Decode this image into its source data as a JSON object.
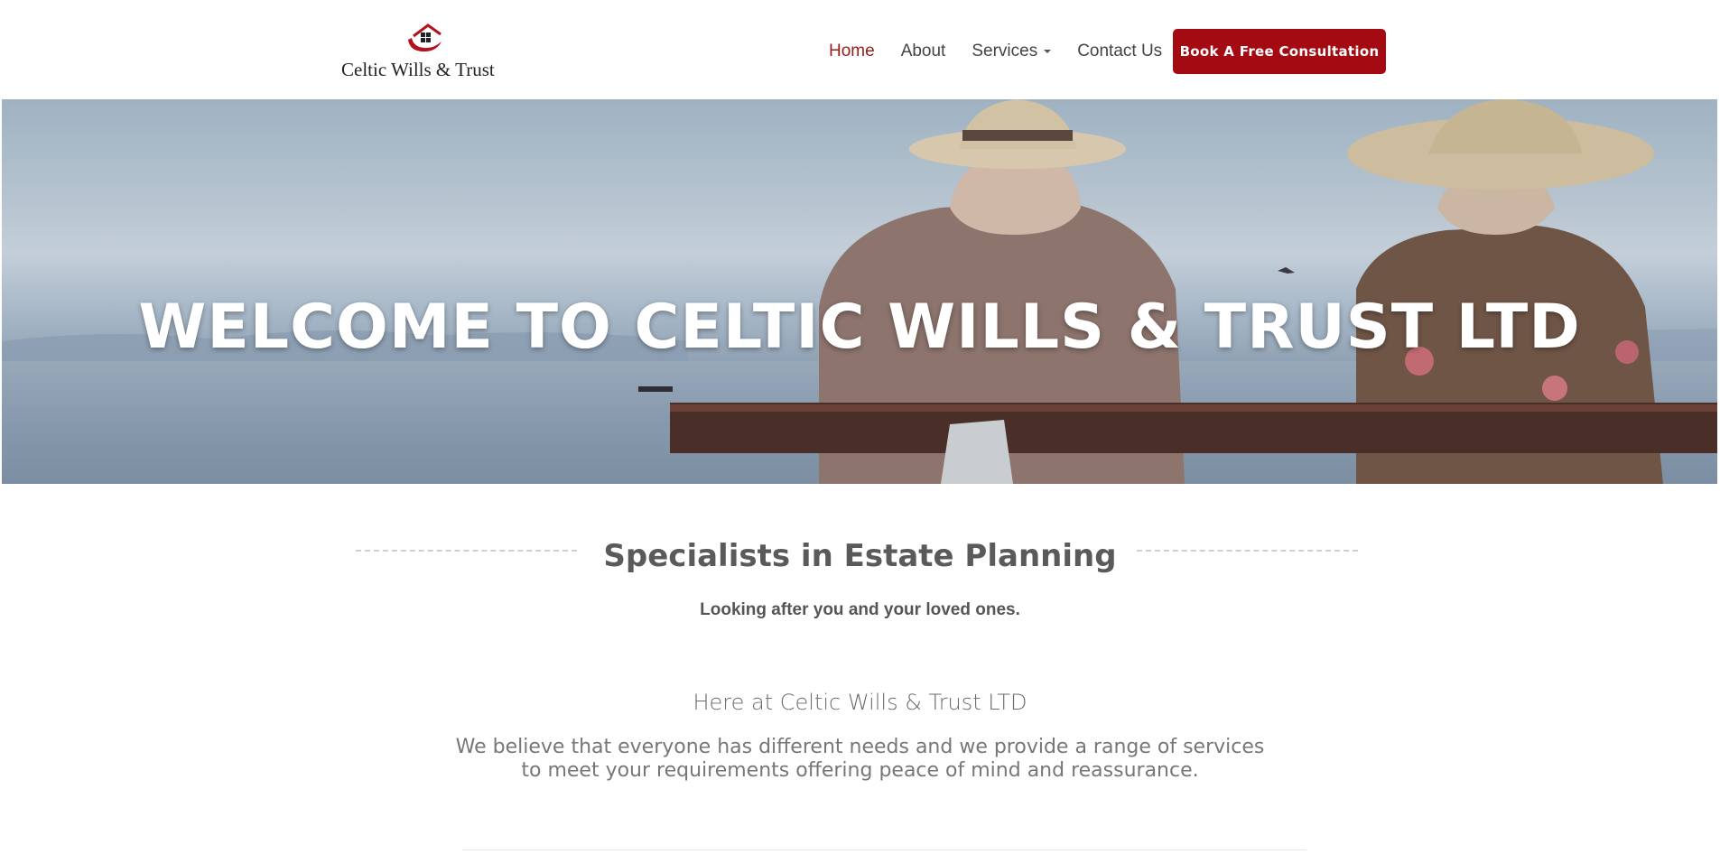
{
  "brand": {
    "name": "Celtic Wills & Trust",
    "accent_color": "#a30a12"
  },
  "nav": {
    "items": [
      {
        "label": "Home",
        "active": true
      },
      {
        "label": "About",
        "active": false
      },
      {
        "label": "Services",
        "active": false,
        "has_dropdown": true
      },
      {
        "label": "Contact Us",
        "active": false
      }
    ],
    "cta_label": "Book A Free Consultation"
  },
  "hero": {
    "title": "WELCOME TO CELTIC WILLS & TRUST LTD"
  },
  "intro": {
    "title": "Specialists in Estate Planning",
    "tagline": "Looking after you and your loved ones.",
    "heading": "Here at Celtic Wills & Trust LTD",
    "body": "We believe that everyone has different needs and we provide a range of services to meet your requirements offering peace of mind and reassurance."
  }
}
